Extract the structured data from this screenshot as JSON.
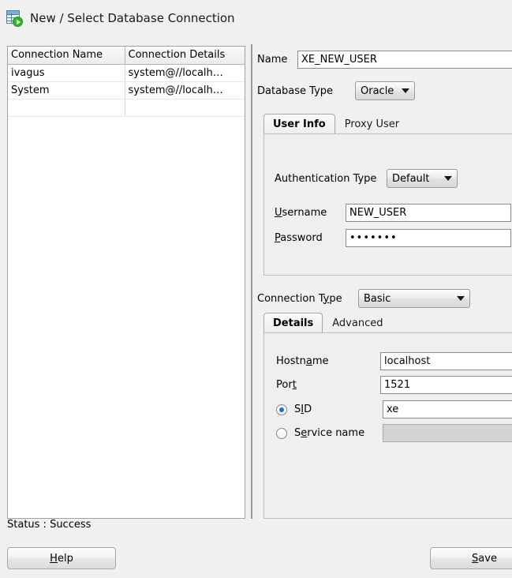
{
  "window": {
    "title": "New / Select Database Connection",
    "icon": "database-connection-icon"
  },
  "connections_table": {
    "columns": [
      "Connection Name",
      "Connection Details"
    ],
    "rows": [
      {
        "name": "ivagus",
        "details": "system@//localh…"
      },
      {
        "name": "System",
        "details": "system@//localh…"
      }
    ]
  },
  "form": {
    "name_label": "Name",
    "name_value": "XE_NEW_USER",
    "database_type_label": "Database Type",
    "database_type_value": "Oracle",
    "tabs_user": [
      {
        "label": "User Info",
        "active": true
      },
      {
        "label": "Proxy User",
        "active": false
      }
    ],
    "authentication_type_label": "Authentication Type",
    "authentication_type_value": "Default",
    "username_label_pre": "U",
    "username_label_post": "sername",
    "username_value": "NEW_USER",
    "password_label_pre": "P",
    "password_label_post": "assword",
    "password_value": "•••••••",
    "connection_type_label_pre": "Connection T",
    "connection_type_label_mid": "y",
    "connection_type_label_post": "pe",
    "connection_type_value": "Basic",
    "tabs_conn": [
      {
        "label": "Details",
        "active": true
      },
      {
        "label": "Advanced",
        "active": false
      }
    ],
    "hostname_label_pre": "Hostn",
    "hostname_label_mid": "a",
    "hostname_label_post": "me",
    "hostname_value": "localhost",
    "port_label_pre": "Por",
    "port_label_mid": "t",
    "port_label_post": "",
    "port_value": "1521",
    "sid_label_pre": "S",
    "sid_label_mid": "I",
    "sid_label_post": "D",
    "sid_value": "xe",
    "sid_selected": true,
    "service_name_label_pre": "S",
    "service_name_label_mid": "e",
    "service_name_label_post": "rvice name",
    "service_name_value": "",
    "service_name_selected": false
  },
  "footer": {
    "status": "Status : Success",
    "help_pre": "",
    "help_mid": "H",
    "help_post": "elp",
    "save_pre": "",
    "save_mid": "S",
    "save_post": "ave"
  },
  "colors": {
    "background": "#f0f0f0",
    "panel": "#efefef",
    "field_background": "#ffffff",
    "disabled_field": "#d4d4d4",
    "radio_accent": "#1f6fd0",
    "icon_green": "#2eb82e",
    "icon_blue": "#4a7fa8"
  }
}
